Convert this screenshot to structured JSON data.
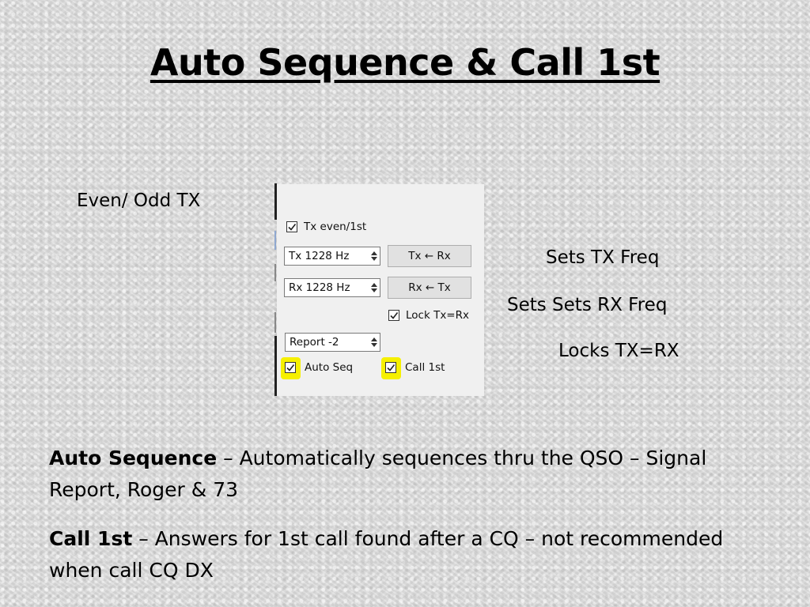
{
  "slide": {
    "title": "Auto Sequence & Call 1st",
    "annotations": {
      "even_odd": "Even/ Odd TX",
      "sets_tx": "Sets TX Freq",
      "sets_rx": "Sets Sets RX Freq",
      "locks": "Locks TX=RX"
    },
    "descriptions": [
      {
        "term": "Auto Sequence",
        "text": " – Automatically sequences thru the QSO – Signal Report, Roger & 73"
      },
      {
        "term": "Call 1st",
        "text": " – Answers for 1st call found after a CQ – not recommended when call CQ DX"
      }
    ]
  },
  "panel": {
    "tx_even_label": "Tx even/1st",
    "tx_even_checked": true,
    "tx_freq_value": "Tx  1228  Hz",
    "tx_from_rx_button": "Tx ← Rx",
    "rx_freq_value": "Rx  1228  Hz",
    "rx_from_tx_button": "Rx ← Tx",
    "lock_label": "Lock Tx=Rx",
    "lock_checked": true,
    "report_value": "Report -2",
    "auto_seq_label": "Auto Seq",
    "auto_seq_checked": true,
    "call_1st_label": "Call 1st",
    "call_1st_checked": true,
    "highlight_color": "#f6f000"
  },
  "icons": {
    "check": "check-icon",
    "spin_up": "triangle-up-icon",
    "spin_down": "triangle-down-icon"
  }
}
